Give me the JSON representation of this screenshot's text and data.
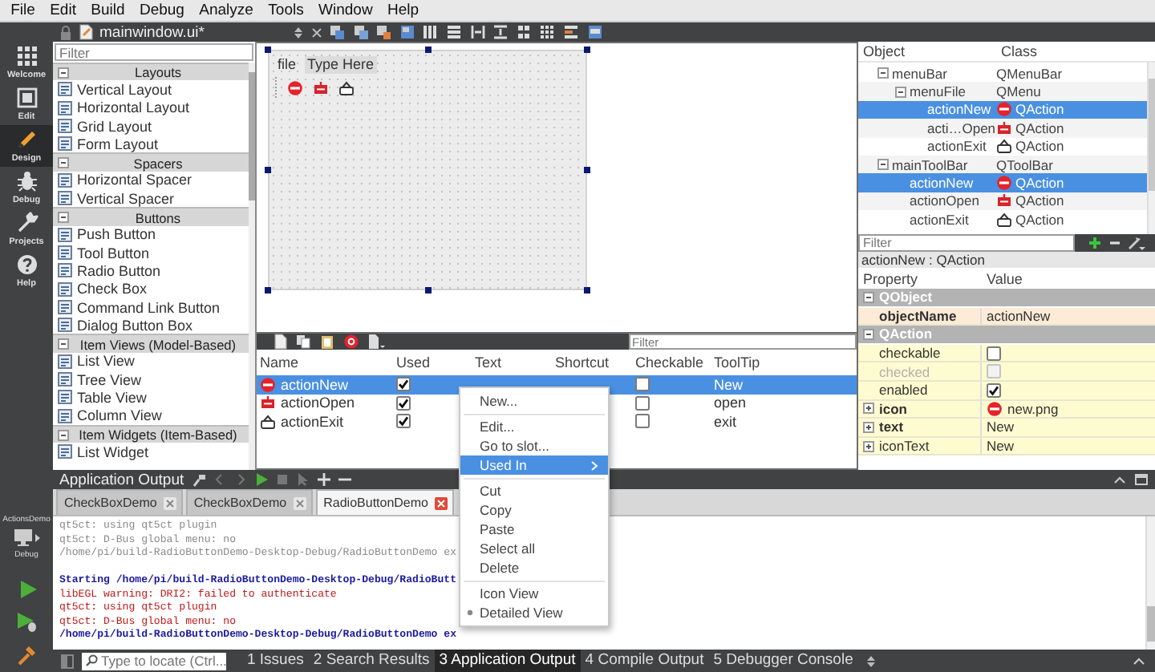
{
  "menu_bar": [
    "File",
    "Edit",
    "Build",
    "Debug",
    "Analyze",
    "Tools",
    "Window",
    "Help"
  ],
  "mode_bar": {
    "modes": [
      {
        "label": "Welcome",
        "selected": false
      },
      {
        "label": "Edit",
        "selected": false
      },
      {
        "label": "Design",
        "selected": true
      },
      {
        "label": "Debug",
        "selected": false
      },
      {
        "label": "Projects",
        "selected": false
      },
      {
        "label": "Help",
        "selected": false
      }
    ],
    "kit": {
      "project": "ActionsDemo",
      "build": "Debug"
    }
  },
  "editor_toolbar": {
    "file": "mainwindow.ui*"
  },
  "widget_box": {
    "placeholder": "Filter",
    "categories": [
      {
        "title": "Layouts",
        "expanded": true,
        "items": [
          "Vertical Layout",
          "Horizontal Layout",
          "Grid Layout",
          "Form Layout"
        ]
      },
      {
        "title": "Spacers",
        "expanded": true,
        "items": [
          "Horizontal Spacer",
          "Vertical Spacer"
        ]
      },
      {
        "title": "Buttons",
        "expanded": true,
        "items": [
          "Push Button",
          "Tool Button",
          "Radio Button",
          "Check Box",
          "Command Link Button",
          "Dialog Button Box"
        ]
      },
      {
        "title": "Item Views (Model-Based)",
        "expanded": true,
        "items": [
          "List View",
          "Tree View",
          "Table View",
          "Column View"
        ]
      },
      {
        "title": "Item Widgets (Item-Based)",
        "expanded": true,
        "items": [
          "List Widget"
        ]
      }
    ]
  },
  "form": {
    "menus": [
      {
        "label": "file",
        "kind": "menu"
      },
      {
        "label": "Type Here",
        "kind": "placeholder"
      }
    ]
  },
  "action_editor": {
    "placeholder": "Filter",
    "columns": [
      "Name",
      "Used",
      "Text",
      "Shortcut",
      "Checkable",
      "ToolTip"
    ],
    "rows": [
      {
        "name": "actionNew",
        "used": true,
        "checkable": false,
        "tooltip": "New",
        "selected": true
      },
      {
        "name": "actionOpen",
        "used": true,
        "checkable": false,
        "tooltip": "open",
        "selected": false
      },
      {
        "name": "actionExit",
        "used": true,
        "checkable": false,
        "tooltip": "exit",
        "selected": false
      }
    ]
  },
  "object_inspector": {
    "columns": [
      "Object",
      "Class"
    ],
    "tree": [
      {
        "object": "menuBar",
        "class": "QMenuBar",
        "expanded": true,
        "selected": false,
        "children": [
          {
            "object": "menuFile",
            "class": "QMenu",
            "expanded": true,
            "selected": false,
            "children": [
              {
                "object": "actionNew",
                "class": "QAction",
                "selected": true
              },
              {
                "object": "acti…Open",
                "class": "QAction",
                "selected": false
              },
              {
                "object": "actionExit",
                "class": "QAction",
                "selected": false
              }
            ]
          }
        ]
      },
      {
        "object": "mainToolBar",
        "class": "QToolBar",
        "expanded": true,
        "selected": false,
        "children": [
          {
            "object": "actionNew",
            "class": "QAction",
            "selected": true
          },
          {
            "object": "actionOpen",
            "class": "QAction",
            "selected": false
          },
          {
            "object": "actionExit",
            "class": "QAction",
            "selected": false
          }
        ]
      }
    ]
  },
  "property_editor": {
    "placeholder": "Filter",
    "title": "actionNew : QAction",
    "columns": [
      "Property",
      "Value"
    ],
    "rows": [
      {
        "kind": "group",
        "name": "QObject",
        "expanded": true
      },
      {
        "kind": "text",
        "name": "objectName",
        "value": "actionNew",
        "modified": true
      },
      {
        "kind": "group",
        "name": "QAction",
        "expanded": true
      },
      {
        "kind": "checkbox",
        "name": "checkable",
        "checked": false,
        "disabled": false,
        "modified": false
      },
      {
        "kind": "checkbox",
        "name": "checked",
        "checked": false,
        "disabled": true,
        "modified": false
      },
      {
        "kind": "checkbox",
        "name": "enabled",
        "checked": true,
        "disabled": false,
        "modified": false
      },
      {
        "kind": "icon",
        "name": "icon",
        "value": "new.png",
        "modified": true,
        "expanded": false
      },
      {
        "kind": "text",
        "name": "text",
        "value": "New",
        "modified": true,
        "expanded": false
      },
      {
        "kind": "text",
        "name": "iconText",
        "value": "New",
        "modified": false,
        "expanded": false
      }
    ]
  },
  "context_menu": {
    "items": [
      {
        "kind": "item",
        "label": "New...",
        "selected": false,
        "submenu": false
      },
      {
        "kind": "separator"
      },
      {
        "kind": "item",
        "label": "Edit...",
        "selected": false,
        "submenu": false
      },
      {
        "kind": "item",
        "label": "Go to slot...",
        "selected": false,
        "submenu": false
      },
      {
        "kind": "item",
        "label": "Used In",
        "selected": true,
        "submenu": true
      },
      {
        "kind": "separator"
      },
      {
        "kind": "item",
        "label": "Cut",
        "selected": false,
        "submenu": false
      },
      {
        "kind": "item",
        "label": "Copy",
        "selected": false,
        "submenu": false
      },
      {
        "kind": "item",
        "label": "Paste",
        "selected": false,
        "submenu": false
      },
      {
        "kind": "item",
        "label": "Select all",
        "selected": false,
        "submenu": false
      },
      {
        "kind": "item",
        "label": "Delete",
        "selected": false,
        "submenu": false
      },
      {
        "kind": "separator"
      },
      {
        "kind": "item",
        "label": "Icon View",
        "selected": false,
        "submenu": false,
        "checked": false
      },
      {
        "kind": "item",
        "label": "Detailed View",
        "selected": false,
        "submenu": false,
        "checked": true
      }
    ]
  },
  "output_pane": {
    "title": "Application Output",
    "tabs": [
      {
        "label": "CheckBoxDemo",
        "selected": false
      },
      {
        "label": "CheckBoxDemo",
        "selected": false
      },
      {
        "label": "RadioButtonDemo",
        "selected": true
      }
    ],
    "lines": [
      {
        "kind": "info",
        "text": "qt5ct: using qt5ct plugin"
      },
      {
        "kind": "info",
        "text": "qt5ct: D-Bus global menu: no"
      },
      {
        "kind": "info",
        "text": "/home/pi/build-RadioButtonDemo-Desktop-Debug/RadioButtonDemo ex"
      },
      {
        "kind": "blank"
      },
      {
        "kind": "start",
        "text": "Starting /home/pi/build-RadioButtonDemo-Desktop-Debug/RadioButt"
      },
      {
        "kind": "error",
        "text": "libEGL warning: DRI2: failed to authenticate"
      },
      {
        "kind": "error",
        "text": "qt5ct: using qt5ct plugin"
      },
      {
        "kind": "error",
        "text": "qt5ct: D-Bus global menu: no"
      },
      {
        "kind": "start",
        "text": "/home/pi/build-RadioButtonDemo-Desktop-Debug/RadioButtonDemo ex"
      }
    ]
  },
  "status_bar": {
    "placeholder": "Type to locate (Ctrl...",
    "panes": [
      {
        "label": "1 Issues",
        "selected": false
      },
      {
        "label": "2 Search Results",
        "selected": false
      },
      {
        "label": "3 Application Output",
        "selected": true
      },
      {
        "label": "4 Compile Output",
        "selected": false
      },
      {
        "label": "5 Debugger Console",
        "selected": false
      }
    ]
  }
}
